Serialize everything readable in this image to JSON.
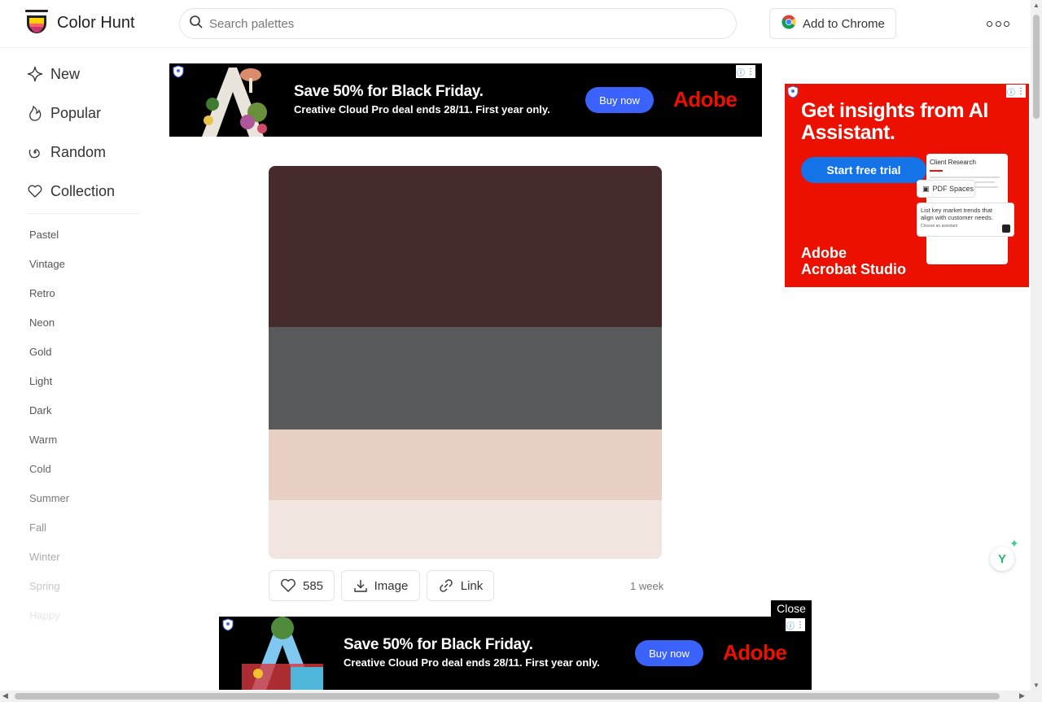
{
  "header": {
    "logo_text": "Color Hunt",
    "search_placeholder": "Search palettes",
    "chrome_button": "Add to Chrome",
    "more_icon": "more-icon"
  },
  "sidebar": {
    "nav": [
      {
        "label": "New",
        "icon": "diamond-icon"
      },
      {
        "label": "Popular",
        "icon": "flame-icon"
      },
      {
        "label": "Random",
        "icon": "spiral-icon"
      },
      {
        "label": "Collection",
        "icon": "heart-icon"
      }
    ],
    "tags": [
      "Pastel",
      "Vintage",
      "Retro",
      "Neon",
      "Gold",
      "Light",
      "Dark",
      "Warm",
      "Cold",
      "Summer",
      "Fall",
      "Winter",
      "Spring",
      "Happy"
    ]
  },
  "top_ad": {
    "headline": "Save 50% for Black Friday.",
    "sub": "Creative Cloud Pro deal ends 28/11. First year only.",
    "cta": "Buy now",
    "brand": "Adobe"
  },
  "side_ad": {
    "headline": "Get insights from AI Assistant.",
    "cta": "Start free trial",
    "brand_line1": "Adobe",
    "brand_line2": "Acrobat Studio",
    "mock_title": "Client Research",
    "mock_chip": "PDF Spaces",
    "mock_prompt": "List key market trends that align with customer needs.",
    "mock_assistant": "Choose an assistant"
  },
  "palette": {
    "colors": [
      "#452b2c",
      "#58595b",
      "#e7cfc3",
      "#f0e6df"
    ],
    "likes": "585",
    "image_label": "Image",
    "link_label": "Link",
    "date": "1 week"
  },
  "bottom_ad": {
    "close_label": "Close",
    "headline": "Save 50% for Black Friday.",
    "sub": "Creative Cloud Pro deal ends 28/11. First year only.",
    "cta": "Buy now",
    "brand": "Adobe"
  }
}
